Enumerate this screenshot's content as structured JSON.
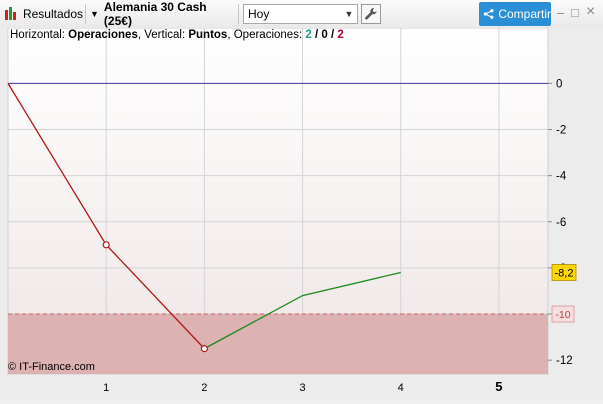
{
  "toolbar": {
    "results_label": "Resultados",
    "instrument_label": "Alemania 30 Cash (25€)",
    "period_value": "Hoy",
    "share_label": "Compartir",
    "minimize_glyph": "–",
    "maximize_glyph": "□",
    "close_glyph": "×",
    "icons": {
      "results": "candlestick-chart-icon",
      "instrument": "dropdown-arrow-icon",
      "period": "chevron-down-icon",
      "settings": "wrench-icon",
      "share": "share-icon"
    }
  },
  "legend": {
    "horizontal_label": "Horizontal:",
    "horizontal_value": "Operaciones",
    "vertical_label": ", Vertical:",
    "vertical_value": "Puntos",
    "operations_label": ", Operaciones:",
    "ops_positive": "2",
    "ops_sep1": " / ",
    "ops_neutral": "0",
    "ops_sep2": " / ",
    "ops_negative": "2"
  },
  "copyright": "© IT-Finance.com",
  "chart_data": {
    "type": "line",
    "x_ticks": [
      "1",
      "2",
      "3",
      "4",
      "5"
    ],
    "y_ticks": [
      "0",
      "-2",
      "-4",
      "-6",
      "-8",
      "-10",
      "-12"
    ],
    "x_range": [
      0,
      5.5
    ],
    "y_range": [
      -12.6,
      2.4
    ],
    "zero_line_color": "#4030a0",
    "loss_series": {
      "color": "#b01818",
      "points": [
        [
          0,
          0
        ],
        [
          1,
          -7
        ],
        [
          2,
          -11.5
        ]
      ]
    },
    "gain_series": {
      "color": "#1a8a1a",
      "points": [
        [
          2,
          -11.5
        ],
        [
          3,
          -9.2
        ],
        [
          4,
          -8.2
        ]
      ]
    },
    "markers": [
      [
        1,
        -7
      ],
      [
        2,
        -11.5
      ]
    ],
    "current_value": -8.2,
    "current_label": "-8,2",
    "current_color": "#ffd700",
    "threshold_value": -10,
    "threshold_label": "-10",
    "threshold_fill": "#d9a8a8",
    "threshold_line": "#d06060"
  }
}
